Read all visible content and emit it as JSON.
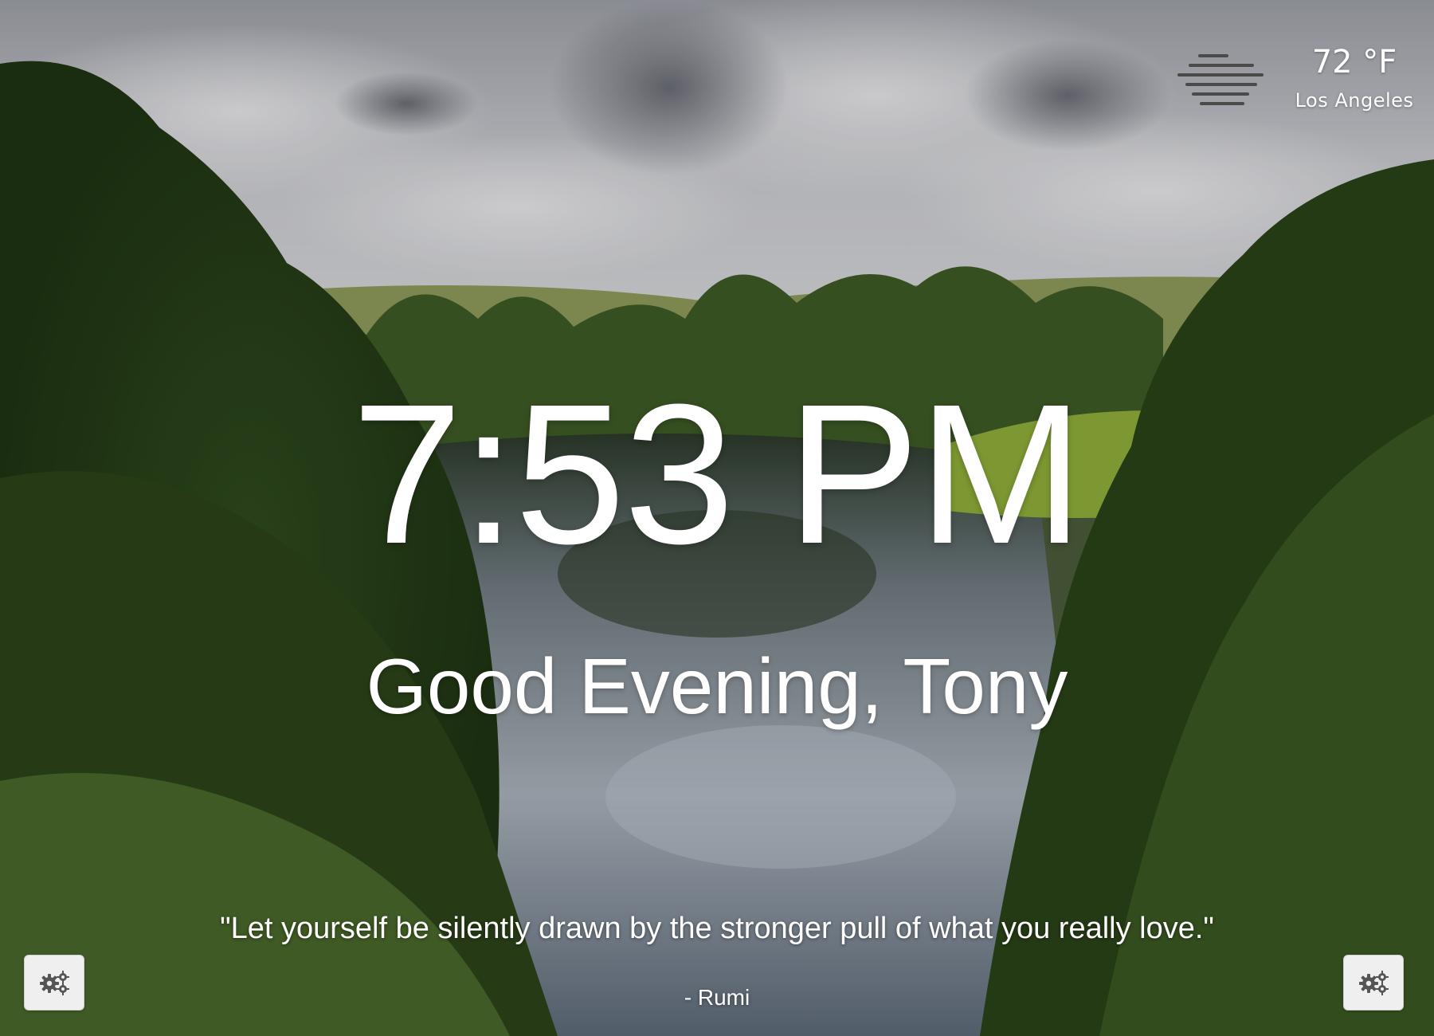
{
  "weather": {
    "temperature": "72 °F",
    "city": "Los Angeles",
    "icon": "fog-icon"
  },
  "clock": {
    "time": "7:53 PM"
  },
  "greeting": {
    "text": "Good Evening, Tony"
  },
  "quote": {
    "text": "\"Let yourself be silently drawn by the stronger pull of what you really love.\"",
    "author": "- Rumi"
  },
  "controls": {
    "left_settings_icon": "gears-icon",
    "right_settings_icon": "gears-icon"
  },
  "colors": {
    "text": "#ffffff",
    "button_bg": "#efefef",
    "icon_gray": "#555555"
  }
}
